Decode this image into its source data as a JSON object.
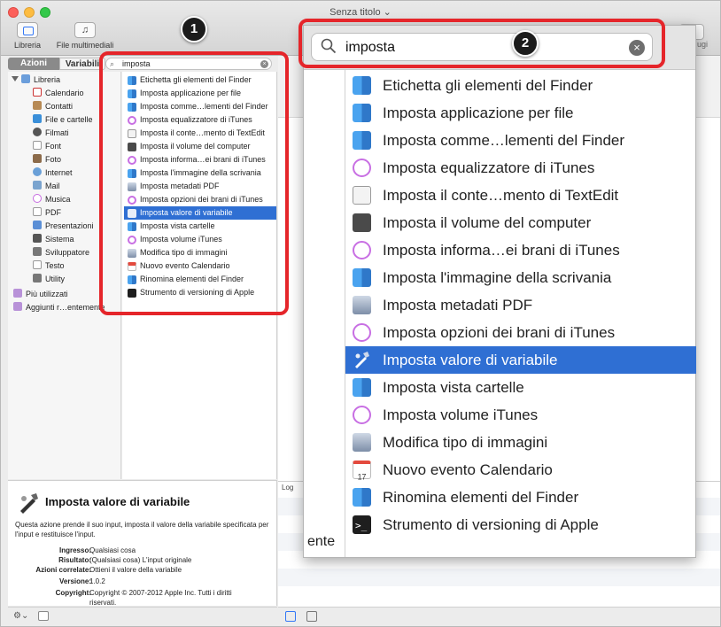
{
  "window": {
    "title": "Senza titolo ⌄"
  },
  "toolbar": {
    "library_label": "Libreria",
    "media_label": "File multimediali",
    "right_ghost": "ugi"
  },
  "left_tabs": {
    "actions": "Azioni",
    "variables": "Variabili"
  },
  "library": {
    "root": "Libreria",
    "items": [
      "Calendario",
      "Contatti",
      "File e cartelle",
      "Filmati",
      "Font",
      "Foto",
      "Internet",
      "Mail",
      "Musica",
      "PDF",
      "Presentazioni",
      "Sistema",
      "Sviluppatore",
      "Testo",
      "Utility"
    ],
    "extra": [
      "Più utilizzati",
      "Aggiunti r…entemente"
    ]
  },
  "small_search": {
    "query": "imposta",
    "clear": "×"
  },
  "actions_small": [
    "Etichetta gli elementi del Finder",
    "Imposta applicazione per file",
    "Imposta comme…lementi del Finder",
    "Imposta equalizzatore di iTunes",
    "Imposta il conte…mento di TextEdit",
    "Imposta il volume del computer",
    "Imposta informa…ei brani di iTunes",
    "Imposta l'immagine della scrivania",
    "Imposta metadati PDF",
    "Imposta opzioni dei brani di iTunes",
    "Imposta valore di variabile",
    "Imposta vista cartelle",
    "Imposta volume iTunes",
    "Modifica tipo di immagini",
    "Nuovo evento Calendario",
    "Rinomina elementi del Finder",
    "Strumento di versioning di Apple"
  ],
  "selected_index": 10,
  "description": {
    "title": "Imposta valore di variabile",
    "text": "Questa azione prende il suo input, imposta il valore della variabile specificata per l'input e restituisce l'input.",
    "rows": [
      {
        "k": "Ingresso:",
        "v": "Qualsiasi cosa"
      },
      {
        "k": "Risultato:",
        "v": "(Qualsiasi cosa) L'input originale"
      },
      {
        "k": "Azioni correlate:",
        "v": "Ottieni il valore della variabile"
      },
      {
        "k": "Versione:",
        "v": "1.0.2"
      },
      {
        "k": "Copyright:",
        "v": "Copyright © 2007-2012 Apple Inc. Tutti i diritti"
      }
    ],
    "copyright_cont": "riservati."
  },
  "footer_left": {
    "gear": "⚙⌄"
  },
  "log": {
    "header": "Log",
    "ente": "ente"
  },
  "zoom": {
    "query": "imposta",
    "clear": "×",
    "items": [
      {
        "label": "Etichetta gli elementi del Finder",
        "icon": "finder-icon"
      },
      {
        "label": "Imposta applicazione per file",
        "icon": "finder-icon"
      },
      {
        "label": "Imposta comme…lementi del Finder",
        "icon": "finder-icon"
      },
      {
        "label": "Imposta equalizzatore di iTunes",
        "icon": "itunes-icon"
      },
      {
        "label": "Imposta il conte…mento di TextEdit",
        "icon": "textedit-icon"
      },
      {
        "label": "Imposta il volume del computer",
        "icon": "volume-icon"
      },
      {
        "label": "Imposta informa…ei brani di iTunes",
        "icon": "itunes-icon"
      },
      {
        "label": "Imposta l'immagine della scrivania",
        "icon": "finder-icon"
      },
      {
        "label": "Imposta metadati PDF",
        "icon": "pdf-icon"
      },
      {
        "label": "Imposta opzioni dei brani di iTunes",
        "icon": "itunes-icon"
      },
      {
        "label": "Imposta valore di variabile",
        "icon": "variable-icon"
      },
      {
        "label": "Imposta vista cartelle",
        "icon": "finder-icon"
      },
      {
        "label": "Imposta volume iTunes",
        "icon": "itunes-icon"
      },
      {
        "label": "Modifica tipo di immagini",
        "icon": "preview-icon"
      },
      {
        "label": "Nuovo evento Calendario",
        "icon": "calendar-icon"
      },
      {
        "label": "Rinomina elementi del Finder",
        "icon": "finder-icon"
      },
      {
        "label": "Strumento di versioning di Apple",
        "icon": "terminal-icon"
      }
    ]
  },
  "annotations": {
    "badge1": "1",
    "badge2": "2",
    "color": "#e5252a"
  },
  "colors": {
    "selection": "#2f6fd3"
  }
}
